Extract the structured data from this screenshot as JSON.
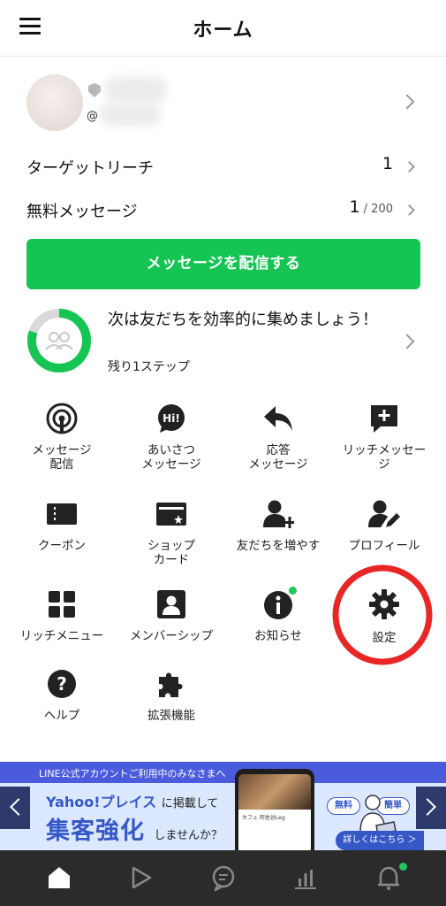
{
  "header": {
    "title": "ホーム"
  },
  "profile": {
    "handle_prefix": "@"
  },
  "stats": [
    {
      "label": "ターゲットリーチ",
      "value": "1",
      "suffix": ""
    },
    {
      "label": "無料メッセージ",
      "value": "1",
      "suffix": " / 200"
    }
  ],
  "send_button": {
    "label": "メッセージを配信する"
  },
  "steps": {
    "line1": "次は友だちを効率的に集めましょう！",
    "line3": "残り1ステップ",
    "progress_fraction": 0.8
  },
  "menu": [
    {
      "label1": "メッセージ",
      "label2": "配信",
      "icon": "broadcast-icon"
    },
    {
      "label1": "あいさつ",
      "label2": "メッセージ",
      "icon": "greeting-hi-icon"
    },
    {
      "label1": "応答",
      "label2": "メッセージ",
      "icon": "reply-icon"
    },
    {
      "label1": "リッチメッセー",
      "label2": "ジ",
      "icon": "rich-message-icon"
    },
    {
      "label1": "クーポン",
      "label2": "",
      "icon": "coupon-icon"
    },
    {
      "label1": "ショップ",
      "label2": "カード",
      "icon": "shop-card-icon"
    },
    {
      "label1": "友だちを増やす",
      "label2": "",
      "icon": "add-friend-icon"
    },
    {
      "label1": "プロフィール",
      "label2": "",
      "icon": "profile-edit-icon"
    },
    {
      "label1": "リッチメニュー",
      "label2": "",
      "icon": "rich-menu-icon"
    },
    {
      "label1": "メンバーシップ",
      "label2": "",
      "icon": "membership-icon"
    },
    {
      "label1": "お知らせ",
      "label2": "",
      "icon": "info-icon"
    },
    {
      "label1": "設定",
      "label2": "",
      "icon": "gear-icon"
    },
    {
      "label1": "ヘルプ",
      "label2": "",
      "icon": "help-icon"
    },
    {
      "label1": "拡張機能",
      "label2": "",
      "icon": "puzzle-icon"
    }
  ],
  "banner": {
    "top_text": "LINE公式アカウントご利用中のみなさまへ",
    "yahoo": "Yahoo!プレイス",
    "yahoo_tail": "に掲載して",
    "big": "集客強化",
    "big_tail": "しませんか？",
    "pill1": "無料",
    "pill2": "簡単",
    "detail": "詳しくはこちら ＞",
    "phone_caption": "カフェ 阿佐谷Leg"
  },
  "tabbar": {
    "tabs": [
      "home-icon",
      "voom-icon",
      "chat-icon",
      "analytics-icon",
      "notification-bell-icon"
    ]
  },
  "colors": {
    "brand_green": "#16c453",
    "tabbar_bg": "#2b2b2b",
    "highlight_red": "#e82626"
  }
}
